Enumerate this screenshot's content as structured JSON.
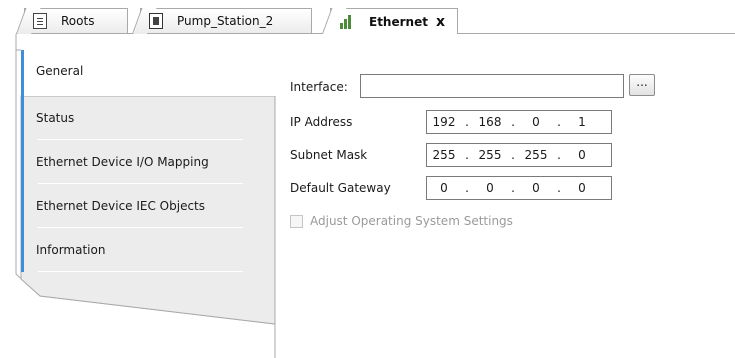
{
  "tabs": [
    {
      "label": "Roots",
      "icon": "document-icon",
      "active": false
    },
    {
      "label": "Pump_Station_2",
      "icon": "device-icon",
      "active": false
    },
    {
      "label": "Ethernet",
      "icon": "ethernet-icon",
      "active": true,
      "close": "x"
    }
  ],
  "nav": {
    "items": [
      {
        "label": "General"
      },
      {
        "label": "Status"
      },
      {
        "label": "Ethernet Device I/O Mapping"
      },
      {
        "label": "Ethernet Device IEC Objects"
      },
      {
        "label": "Information"
      }
    ],
    "accent_color": "#3f8fd8",
    "panel_color": "#ececec"
  },
  "form": {
    "interface": {
      "label": "Interface:",
      "value": "",
      "browse_label": "..."
    },
    "ip_address": {
      "label": "IP Address",
      "octets": [
        "192",
        "168",
        "0",
        "1"
      ]
    },
    "subnet_mask": {
      "label": "Subnet Mask",
      "octets": [
        "255",
        "255",
        "255",
        "0"
      ]
    },
    "default_gateway": {
      "label": "Default Gateway",
      "octets": [
        "0",
        "0",
        "0",
        "0"
      ]
    },
    "adjust_os": {
      "label": "Adjust Operating System Settings",
      "checked": false,
      "enabled": false
    }
  }
}
